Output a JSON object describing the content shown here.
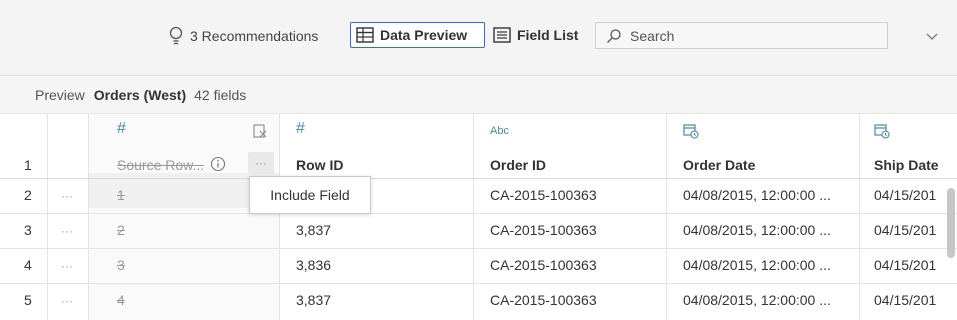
{
  "toolbar": {
    "recommendations_label": "3 Recommendations",
    "data_preview_label": "Data Preview",
    "field_list_label": "Field List",
    "search_placeholder": "Search"
  },
  "preview_bar": {
    "label": "Preview",
    "source_name": "Orders (West)",
    "field_count": "42 fields"
  },
  "header": {
    "row_number": "1",
    "columns": [
      {
        "type_icon": "#",
        "name": "Source Row...",
        "excluded": true
      },
      {
        "type_icon": "#",
        "name": "Row ID"
      },
      {
        "type_icon": "Abc",
        "name": "Order ID"
      },
      {
        "type_icon": "date-time-icon",
        "name": "Order Date"
      },
      {
        "type_icon": "date-time-icon",
        "name": "Ship Date"
      }
    ]
  },
  "rows": [
    {
      "num": "2",
      "menu": "···",
      "source_row": "1",
      "row_id": "",
      "order_id": "CA-2015-100363",
      "order_date": "04/08/2015, 12:00:00 ...",
      "ship_date": "04/15/201"
    },
    {
      "num": "3",
      "menu": "···",
      "source_row": "2",
      "row_id": "3,837",
      "order_id": "CA-2015-100363",
      "order_date": "04/08/2015, 12:00:00 ...",
      "ship_date": "04/15/201"
    },
    {
      "num": "4",
      "menu": "···",
      "source_row": "3",
      "row_id": "3,836",
      "order_id": "CA-2015-100363",
      "order_date": "04/08/2015, 12:00:00 ...",
      "ship_date": "04/15/201"
    },
    {
      "num": "5",
      "menu": "···",
      "source_row": "4",
      "row_id": "3,837",
      "order_id": "CA-2015-100363",
      "order_date": "04/08/2015, 12:00:00 ...",
      "ship_date": "04/15/201"
    }
  ],
  "column_menu": {
    "dots": "···"
  },
  "tooltip": {
    "label": "Include Field"
  },
  "colors": {
    "accent_blue": "#2f6fd6",
    "type_icon": "#4a8aa8",
    "grid_line": "#e4e4e4",
    "toolbar_bg": "#f4f4f4"
  }
}
